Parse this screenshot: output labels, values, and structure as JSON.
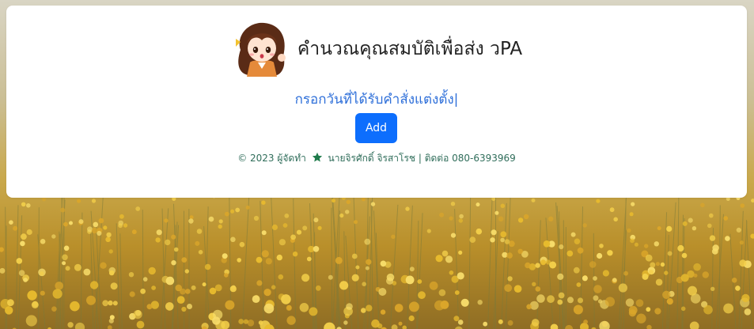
{
  "header": {
    "title": "คำนวณคุณสมบัติเพื่อส่ง วPA",
    "avatar_icon": "girl-mascot-icon"
  },
  "form": {
    "prompt": "กรอกวันที่ได้รับคำสั่งแต่งตั้ง|",
    "add_label": "Add"
  },
  "footer": {
    "copyright": "© 2023 ผู้จัดทำ",
    "star_icon": "star-icon",
    "author_contact": "นายจิรศักดิ์ จิรสาโรช | ติดต่อ 080-6393969"
  },
  "colors": {
    "primary_button": "#0d6efd",
    "prompt_text": "#2e6fd9",
    "footer_text": "#2f6d5a",
    "star": "#1e7b4b"
  }
}
